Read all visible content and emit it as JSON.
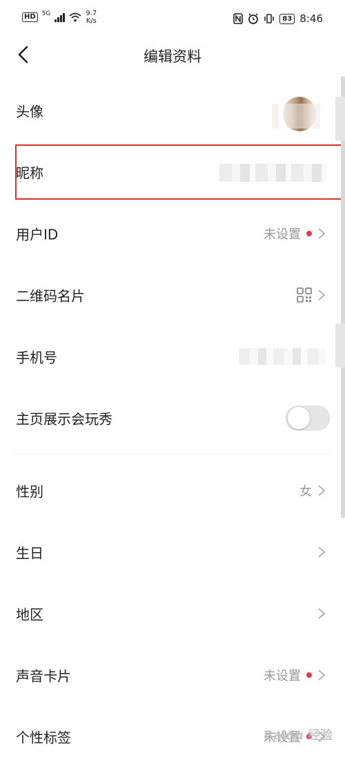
{
  "status_bar": {
    "network_badge": "HD",
    "signal_type": "5G",
    "speed_value": "9.7",
    "speed_unit": "K/s",
    "battery": "83",
    "time": "8:46"
  },
  "header": {
    "title": "编辑资料"
  },
  "rows": {
    "avatar": {
      "label": "头像"
    },
    "nickname": {
      "label": "昵称"
    },
    "user_id": {
      "label": "用户ID",
      "value": "未设置"
    },
    "qr_card": {
      "label": "二维码名片"
    },
    "phone": {
      "label": "手机号"
    },
    "homepage_show": {
      "label": "主页展示会玩秀",
      "toggle_on": false
    },
    "gender": {
      "label": "性别",
      "value": "女"
    },
    "birthday": {
      "label": "生日"
    },
    "region": {
      "label": "地区"
    },
    "voice_card": {
      "label": "声音卡片",
      "value": "未设置"
    },
    "tags": {
      "label": "个性标签",
      "value": "未设置"
    }
  },
  "colors": {
    "accent_red": "#e8374b",
    "highlight_border": "#e0302a"
  },
  "watermark": "Baidu 经验"
}
